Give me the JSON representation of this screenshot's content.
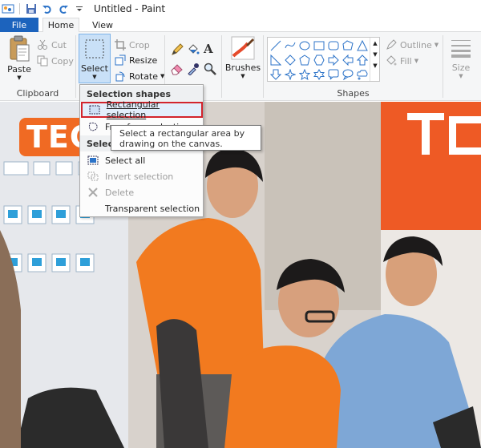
{
  "window": {
    "title": "Untitled - Paint"
  },
  "tabs": [
    {
      "label": "File"
    },
    {
      "label": "Home"
    },
    {
      "label": "View"
    }
  ],
  "ribbon": {
    "clipboard": {
      "paste_label": "Paste",
      "cut_label": "Cut",
      "copy_label": "Copy",
      "group_label": "Clipboard"
    },
    "image": {
      "select_label": "Select",
      "crop_label": "Crop",
      "resize_label": "Resize",
      "rotate_label": "Rotate"
    },
    "brushes": {
      "label": "Brushes"
    },
    "shapes": {
      "group_label": "Shapes",
      "outline_label": "Outline",
      "fill_label": "Fill"
    },
    "size": {
      "label": "Size"
    }
  },
  "select_menu": {
    "section_shapes": "Selection shapes",
    "rectangular": "Rectangular selection",
    "freeform": "Free-form selection",
    "section_options": "Selection options",
    "select_all": "Select all",
    "invert": "Invert selection",
    "delete": "Delete",
    "transparent": "Transparent selection"
  },
  "tooltip": {
    "line1": "Select a rectangular area by",
    "line2": "drawing on the canvas."
  },
  "canvas": {
    "sign_text": "TEC"
  },
  "colors": {
    "file_tab": "#1c63bd",
    "highlight_border": "#d3242c",
    "select_active": "#c9e0f7",
    "orange_shirt": "#f27a1f"
  }
}
